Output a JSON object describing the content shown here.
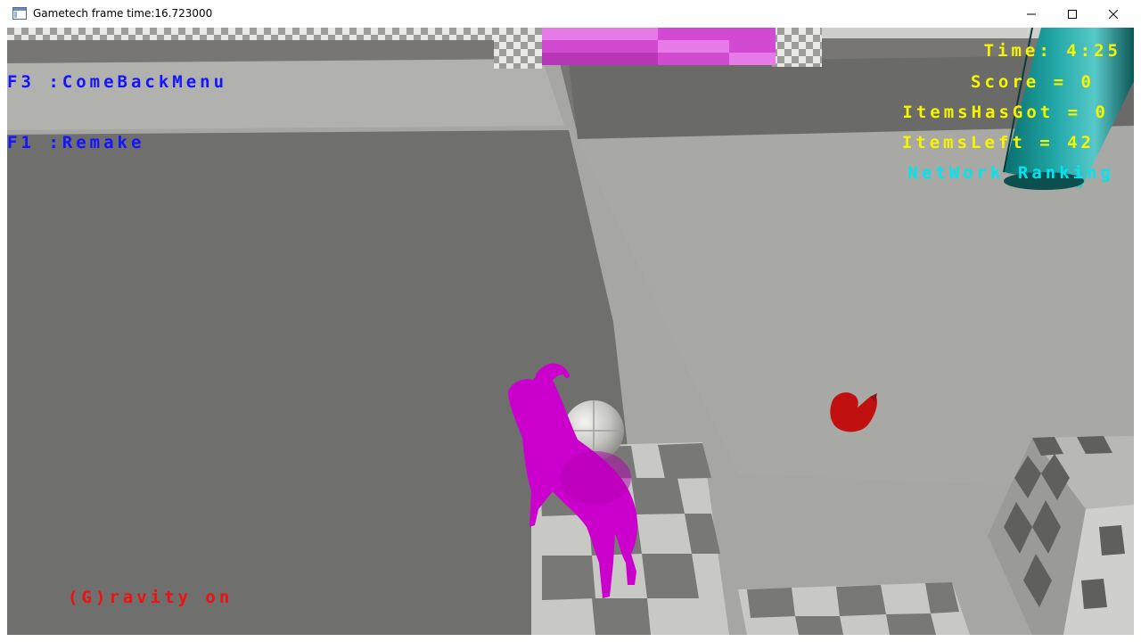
{
  "window": {
    "title": "Gametech frame time:16.723000"
  },
  "hud": {
    "menu_hint": "F3 :ComeBackMenu",
    "remake_hint": "F1 :Remake",
    "time": "Time: 4:25",
    "score": "Score = 0",
    "items_got": "ItemsHasGot = 0",
    "items_left": "ItemsLeft = 42",
    "network_ranking": "NetWork Ranking",
    "gravity": "(G)ravity on"
  },
  "colors": {
    "hud_blue": "#1414ff",
    "hud_yellow": "#f5f500",
    "hud_cyan": "#00e5ee",
    "hud_red": "#f01010",
    "goat": "#cc00cc",
    "duck": "#c01010"
  },
  "icons": {
    "app": "window-app-icon",
    "minimize": "minimize-icon",
    "maximize": "maximize-icon",
    "close": "close-icon"
  }
}
